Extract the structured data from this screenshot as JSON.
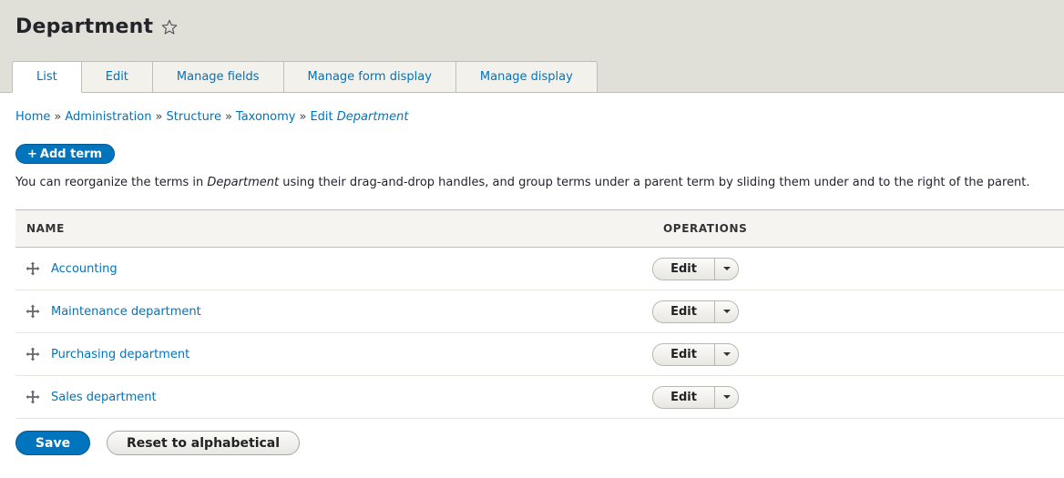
{
  "page": {
    "title": "Department"
  },
  "tabs": [
    {
      "label": "List",
      "active": true
    },
    {
      "label": "Edit",
      "active": false
    },
    {
      "label": "Manage fields",
      "active": false
    },
    {
      "label": "Manage form display",
      "active": false
    },
    {
      "label": "Manage display",
      "active": false
    }
  ],
  "breadcrumb": {
    "items": [
      "Home",
      "Administration",
      "Structure",
      "Taxonomy"
    ],
    "separator": "»",
    "current_prefix": "Edit ",
    "current_em": "Department"
  },
  "add_term": {
    "plus": "+",
    "label": "Add term"
  },
  "help": {
    "before": "You can reorganize the terms in ",
    "em": "Department",
    "after": " using their drag-and-drop handles, and group terms under a parent term by sliding them under and to the right of the parent."
  },
  "table": {
    "headers": {
      "name": "NAME",
      "operations": "OPERATIONS"
    },
    "rows": [
      {
        "name": "Accounting",
        "op": "Edit"
      },
      {
        "name": "Maintenance department",
        "op": "Edit"
      },
      {
        "name": "Purchasing department",
        "op": "Edit"
      },
      {
        "name": "Sales department",
        "op": "Edit"
      }
    ]
  },
  "actions": {
    "save": "Save",
    "reset": "Reset to alphabetical"
  },
  "icons": {
    "favorite": "star-outline-icon",
    "drag": "move-arrows-icon",
    "dropdown": "caret-down-icon"
  },
  "colors": {
    "link": "#0074bd",
    "primary_button": "#0074bd",
    "header_bg": "#e0dfd8"
  }
}
